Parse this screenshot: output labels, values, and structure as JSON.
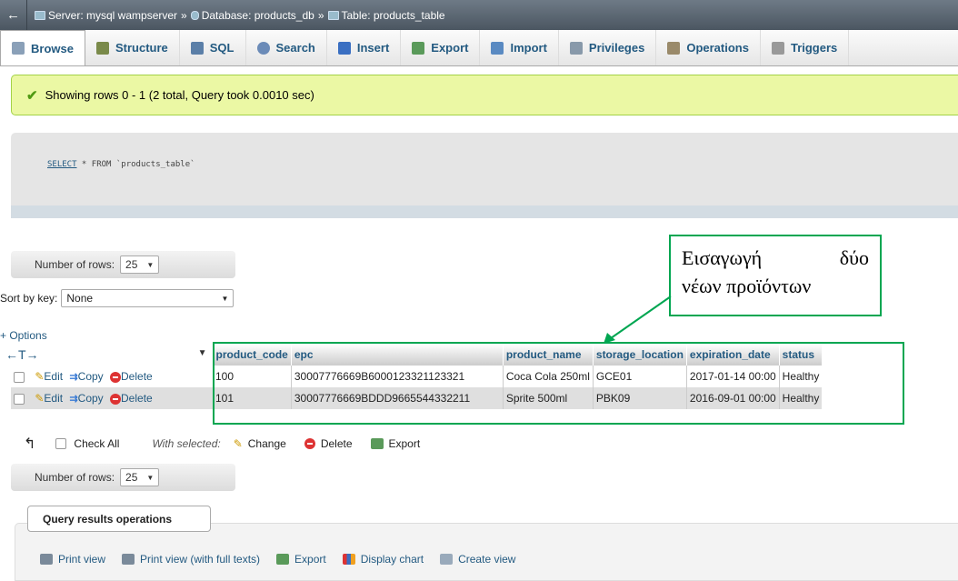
{
  "breadcrumb": {
    "back": "←",
    "server": "Server: mysql wampserver",
    "database": "Database: products_db",
    "table": "Table: products_table"
  },
  "tabs": [
    {
      "label": "Browse",
      "color": "#8aa0b8"
    },
    {
      "label": "Structure",
      "color": "#7a8a4a"
    },
    {
      "label": "SQL",
      "color": "#5b7fa8"
    },
    {
      "label": "Search",
      "color": "#6b8bb8"
    },
    {
      "label": "Insert",
      "color": "#3a6fc2"
    },
    {
      "label": "Export",
      "color": "#5a9a5a"
    },
    {
      "label": "Import",
      "color": "#5a8ac2"
    },
    {
      "label": "Privileges",
      "color": "#8899aa"
    },
    {
      "label": "Operations",
      "color": "#9a8a6a"
    },
    {
      "label": "Triggers",
      "color": "#999999"
    }
  ],
  "message": "Showing rows 0 - 1 (2 total, Query took 0.0010 sec)",
  "sql": {
    "keyword": "SELECT",
    "rest": " * FROM `products_table`"
  },
  "nav": {
    "label": "Number of rows:",
    "value": "25"
  },
  "sort": {
    "label": "Sort by key:",
    "value": "None"
  },
  "options_label": "+ Options",
  "arrows": "←T→",
  "table": {
    "headers": [
      "product_code",
      "epc",
      "product_name",
      "storage_location",
      "expiration_date",
      "status"
    ],
    "action_labels": {
      "edit": "Edit",
      "copy": "Copy",
      "delete": "Delete"
    },
    "rows": [
      [
        "100",
        "30007776669B6000123321123321",
        "Coca Cola 250ml",
        "GCE01",
        "2017-01-14 00:00",
        "Healthy"
      ],
      [
        "101",
        "30007776669BDDD9665544332211",
        "Sprite 500ml",
        "PBK09",
        "2016-09-01 00:00",
        "Healthy"
      ]
    ]
  },
  "bulk": {
    "check_all": "Check All",
    "with_selected": "With selected:",
    "change": "Change",
    "delete": "Delete",
    "export": "Export"
  },
  "ops": {
    "legend": "Query results operations",
    "links": [
      "Print view",
      "Print view (with full texts)",
      "Export",
      "Display chart",
      "Create view"
    ]
  },
  "callout": {
    "line1a": "Εισαγωγή",
    "line1b": "δύο",
    "line2": "νέων προϊόντων"
  },
  "colors": {
    "accent": "#235a81",
    "callout_border": "#00a651",
    "success_bg": "#ebf8a4"
  }
}
